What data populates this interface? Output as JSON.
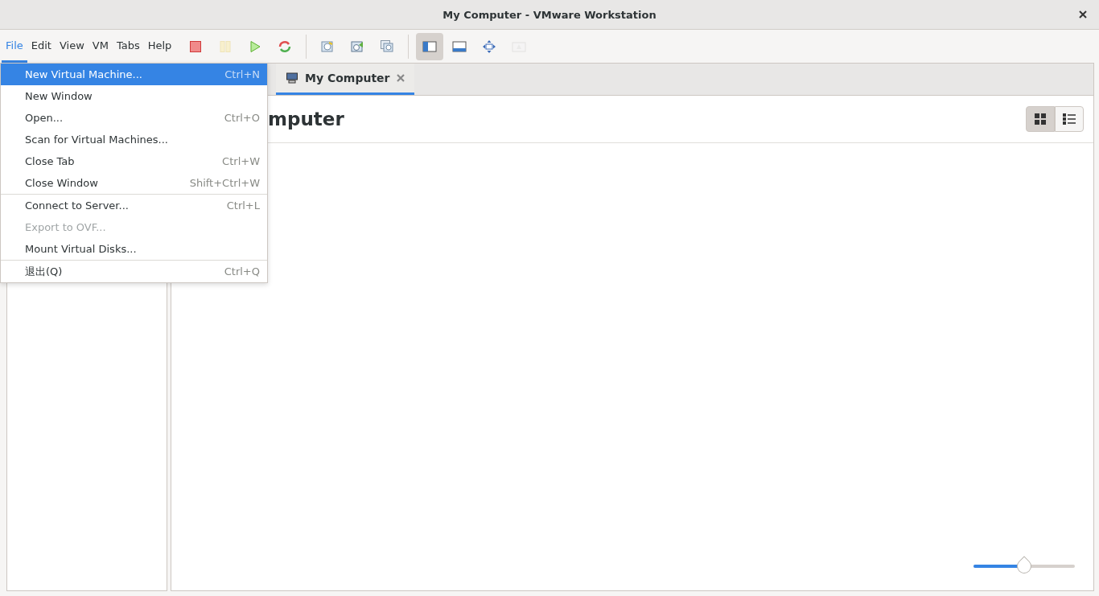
{
  "window": {
    "title": "My Computer - VMware Workstation"
  },
  "menubar": [
    {
      "label": "File",
      "selected": true
    },
    {
      "label": "Edit",
      "selected": false
    },
    {
      "label": "View",
      "selected": false
    },
    {
      "label": "VM",
      "selected": false
    },
    {
      "label": "Tabs",
      "selected": false
    },
    {
      "label": "Help",
      "selected": false
    }
  ],
  "toolbar": [
    {
      "kind": "stop",
      "selected": false,
      "disabled": false
    },
    {
      "kind": "pause",
      "selected": false,
      "disabled": true
    },
    {
      "kind": "play",
      "selected": false,
      "disabled": false
    },
    {
      "kind": "restart",
      "selected": false,
      "disabled": false
    },
    {
      "kind": "snapshot",
      "selected": false,
      "disabled": false
    },
    {
      "kind": "revert",
      "selected": false,
      "disabled": false
    },
    {
      "kind": "manager",
      "selected": false,
      "disabled": false
    },
    {
      "kind": "sidebar",
      "selected": true,
      "disabled": false
    },
    {
      "kind": "thumbs",
      "selected": false,
      "disabled": false
    },
    {
      "kind": "fullscreen",
      "selected": false,
      "disabled": false
    },
    {
      "kind": "unity",
      "selected": false,
      "disabled": true
    }
  ],
  "file_menu": [
    {
      "label": "New Virtual Machine...",
      "shortcut": "Ctrl+N",
      "selected": true,
      "disabled": false,
      "separator_before": false
    },
    {
      "label": "New Window",
      "selected": false,
      "disabled": false,
      "separator_before": false
    },
    {
      "label": "Open...",
      "shortcut": "Ctrl+O",
      "selected": false,
      "disabled": false,
      "separator_before": false
    },
    {
      "label": "Scan for Virtual Machines...",
      "selected": false,
      "disabled": false,
      "separator_before": false
    },
    {
      "label": "Close Tab",
      "shortcut": "Ctrl+W",
      "selected": false,
      "disabled": false,
      "separator_before": false
    },
    {
      "label": "Close Window",
      "shortcut": "Shift+Ctrl+W",
      "selected": false,
      "disabled": false,
      "separator_before": false
    },
    {
      "label": "Connect to Server...",
      "shortcut": "Ctrl+L",
      "selected": false,
      "disabled": false,
      "separator_before": true
    },
    {
      "label": "Export to OVF...",
      "selected": false,
      "disabled": true,
      "separator_before": false
    },
    {
      "label": "Mount Virtual Disks...",
      "selected": false,
      "disabled": false,
      "separator_before": false
    },
    {
      "label": "退出(Q)",
      "shortcut": "Ctrl+Q",
      "selected": false,
      "disabled": false,
      "separator_before": true
    }
  ],
  "tabs": [
    {
      "label": "My Computer",
      "selected": true
    }
  ],
  "page": {
    "heading": "mputer"
  },
  "view_toggle": [
    {
      "kind": "grid",
      "selected": true
    },
    {
      "kind": "list",
      "selected": false
    }
  ],
  "zoom_slider": {
    "level": 0.5
  }
}
